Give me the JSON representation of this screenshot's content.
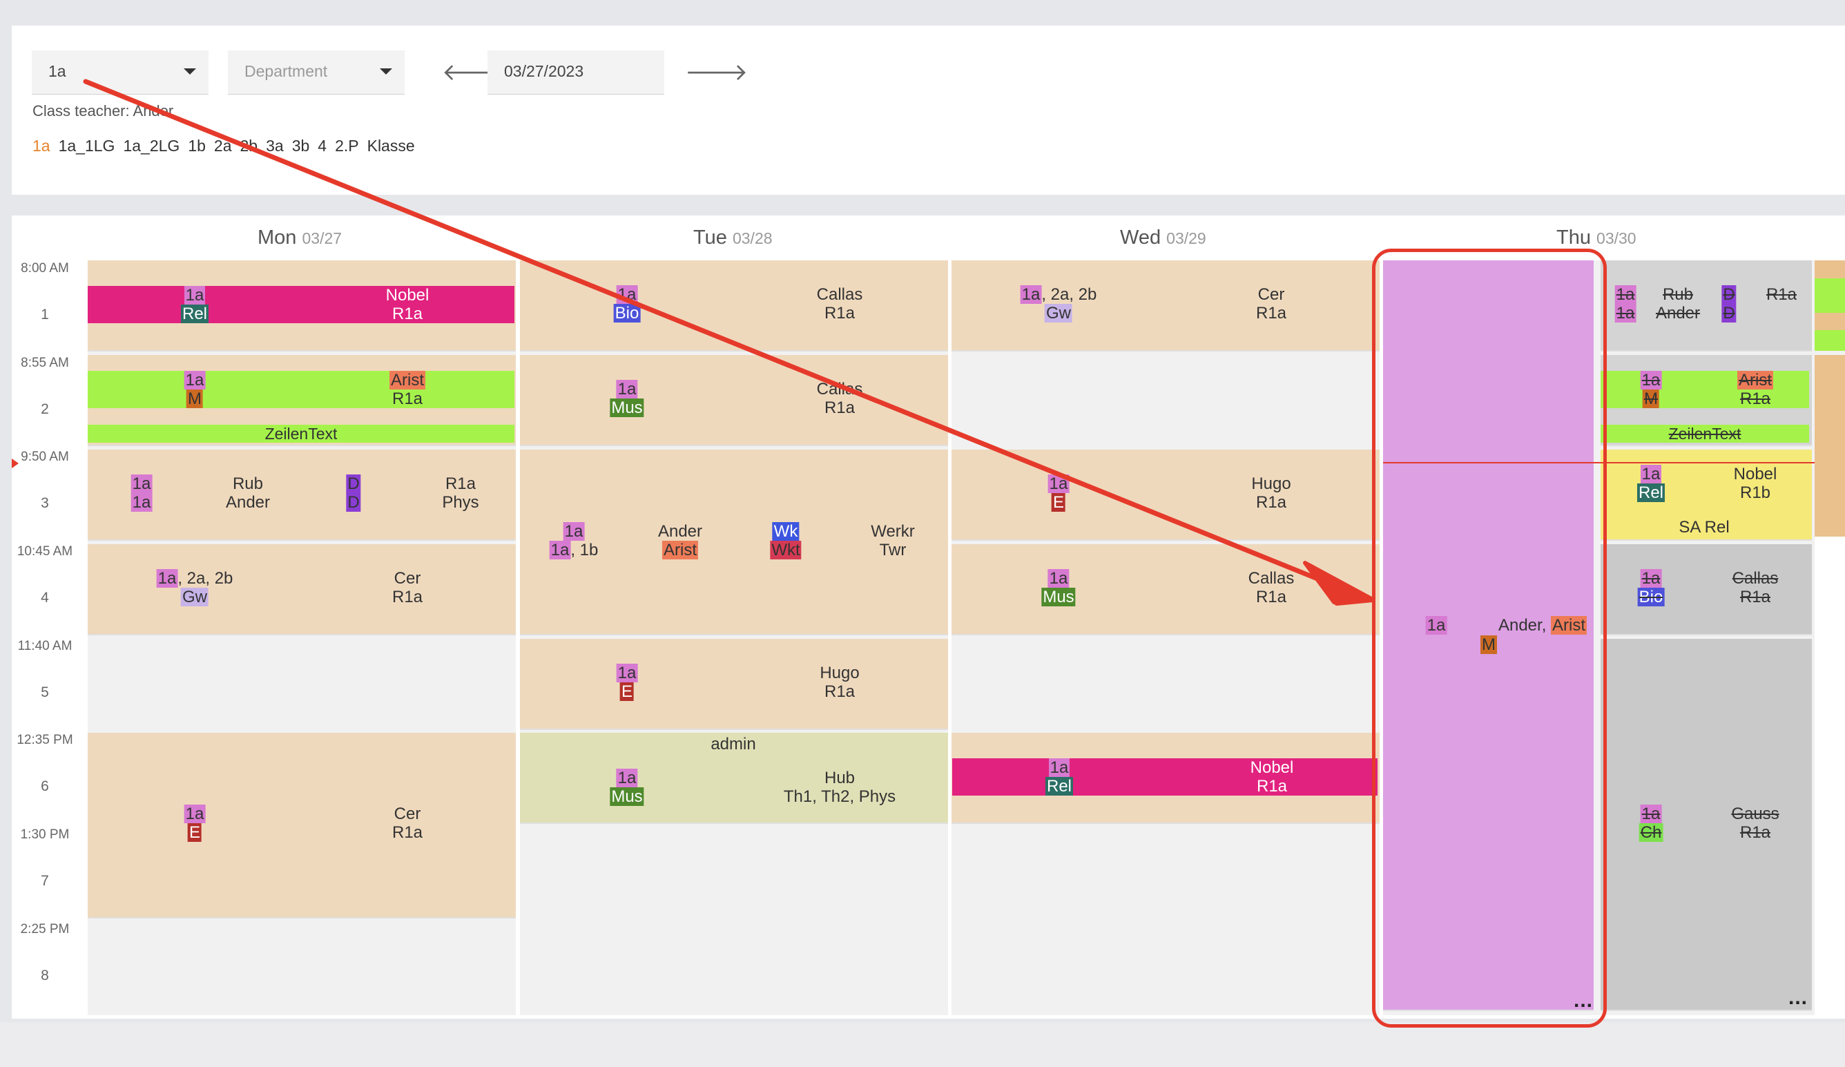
{
  "toolbar": {
    "class_select": "1a",
    "department_placeholder": "Department",
    "date": "03/27/2023",
    "class_teacher": "Class teacher: Ander",
    "class_links": [
      "1a",
      "1a_1LG",
      "1a_2LG",
      "1b",
      "2a",
      "2b",
      "3a",
      "3b",
      "4",
      "2.P",
      "Klasse"
    ]
  },
  "days": [
    {
      "name": "Mon",
      "date": "03/27"
    },
    {
      "name": "Tue",
      "date": "03/28"
    },
    {
      "name": "Wed",
      "date": "03/29"
    },
    {
      "name": "Thu",
      "date": "03/30"
    }
  ],
  "times": [
    "8:00 AM",
    "8:55 AM",
    "9:50 AM",
    "10:45 AM",
    "11:40 AM",
    "12:35 PM",
    "1:30 PM",
    "2:25 PM"
  ],
  "periods": [
    "1",
    "2",
    "3",
    "4",
    "5",
    "6",
    "7",
    "8"
  ],
  "lessons": {
    "mon": {
      "p1": {
        "c": "1a",
        "s": "Rel",
        "t": "Nobel",
        "r": "R1a"
      },
      "p2": {
        "c": "1a",
        "s": "M",
        "t": "Arist",
        "r": "R1a",
        "note": "ZeilenText"
      },
      "p3": {
        "c1": "1a",
        "c2": "1a",
        "t1": "Rub",
        "t2": "Ander",
        "d1": "D",
        "d2": "D",
        "r1": "R1a",
        "r2": "Phys"
      },
      "p4": {
        "c": "1a, 2a, 2b",
        "s": "Gw",
        "t": "Cer",
        "r": "R1a"
      },
      "p67": {
        "c": "1a",
        "s": "E",
        "t": "Cer",
        "r": "R1a"
      }
    },
    "tue": {
      "p1": {
        "c": "1a",
        "s": "Bio",
        "t": "Callas",
        "r": "R1a"
      },
      "p2": {
        "c": "1a",
        "s": "Mus",
        "t": "Callas",
        "r": "R1a"
      },
      "p34": {
        "c1": "1a",
        "c2": "1a, 1b",
        "t1": "Ander",
        "t2": "Arist",
        "w1": "Wk",
        "w2": "Wkt",
        "r1": "Werkr",
        "r2": "Twr"
      },
      "p5": {
        "c": "1a",
        "s": "E",
        "t": "Hugo",
        "r": "R1a"
      },
      "p6": {
        "title": "admin",
        "c": "1a",
        "s": "Mus",
        "t": "Hub",
        "r": "Th1, Th2, Phys"
      }
    },
    "wed": {
      "p1": {
        "c": "1a, 2a, 2b",
        "s": "Gw",
        "t": "Cer",
        "r": "R1a"
      },
      "p3": {
        "c": "1a",
        "s": "E",
        "t": "Hugo",
        "r": "R1a"
      },
      "p4": {
        "c": "1a",
        "s": "Mus",
        "t": "Callas",
        "r": "R1a"
      },
      "p6": {
        "c": "1a",
        "s": "Rel",
        "t": "Nobel",
        "r": "R1a"
      }
    },
    "thu": {
      "main": {
        "c": "1a",
        "t": "Ander",
        "t2": "Arist",
        "s": "M",
        "more": "..."
      },
      "p1": {
        "c1": "1a",
        "c2": "1a",
        "t1": "Rub",
        "t2": "Ander",
        "d1": "D",
        "d2": "D",
        "r": "R1a"
      },
      "p2": {
        "c": "1a",
        "s": "M",
        "t": "Arist",
        "r": "R1a",
        "note": "ZeilenText"
      },
      "p3": {
        "c": "1a",
        "s": "Rel",
        "t": "Nobel",
        "r": "R1b",
        "note": "SA Rel"
      },
      "p4": {
        "c": "1a",
        "s": "Bio",
        "t": "Callas",
        "r": "R1a"
      },
      "p567": {
        "c": "1a",
        "s": "Ch",
        "t": "Gauss",
        "r": "R1a",
        "more": "..."
      }
    }
  },
  "colors": {
    "accent": "#e8832a",
    "annotation": "#e53a2b",
    "lesson": "#efd9bd",
    "cancelled": "#c9c9c9",
    "selected": "#dca0e3"
  }
}
